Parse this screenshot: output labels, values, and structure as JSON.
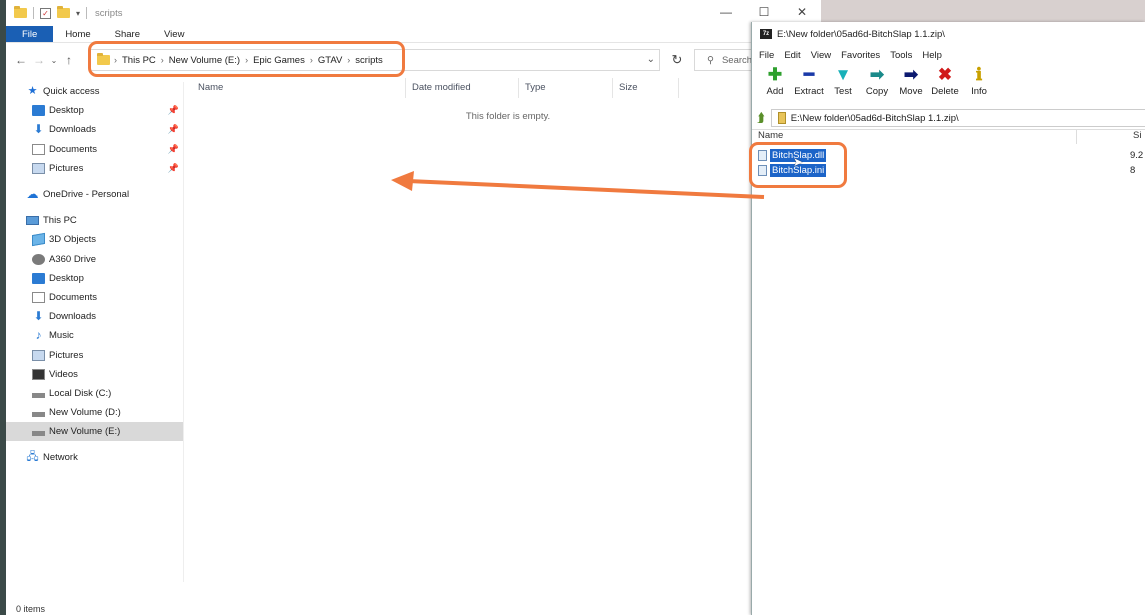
{
  "explorer": {
    "window_title": "scripts",
    "ribbon_tabs": [
      "File",
      "Home",
      "Share",
      "View"
    ],
    "breadcrumb": [
      "This PC",
      "New Volume (E:)",
      "Epic Games",
      "GTAV",
      "scripts"
    ],
    "search_placeholder": "Search",
    "nav_pane": [
      {
        "label": "Quick access",
        "icon": "star-icon",
        "pinned": false
      },
      {
        "label": "Desktop",
        "icon": "desktop-icon",
        "pinned": true
      },
      {
        "label": "Downloads",
        "icon": "download-icon",
        "pinned": true
      },
      {
        "label": "Documents",
        "icon": "documents-icon",
        "pinned": true
      },
      {
        "label": "Pictures",
        "icon": "pictures-icon",
        "pinned": true
      },
      {
        "label": "OneDrive - Personal",
        "icon": "cloud-icon",
        "pinned": false
      },
      {
        "label": "This PC",
        "icon": "computer-icon",
        "pinned": false
      },
      {
        "label": "3D Objects",
        "icon": "cube-icon",
        "pinned": false
      },
      {
        "label": "A360 Drive",
        "icon": "a360-icon",
        "pinned": false
      },
      {
        "label": "Desktop",
        "icon": "desktop-icon",
        "pinned": false
      },
      {
        "label": "Documents",
        "icon": "documents-icon",
        "pinned": false
      },
      {
        "label": "Downloads",
        "icon": "download-icon",
        "pinned": false
      },
      {
        "label": "Music",
        "icon": "music-icon",
        "pinned": false
      },
      {
        "label": "Pictures",
        "icon": "pictures-icon",
        "pinned": false
      },
      {
        "label": "Videos",
        "icon": "videos-icon",
        "pinned": false
      },
      {
        "label": "Local Disk (C:)",
        "icon": "drive-icon",
        "pinned": false
      },
      {
        "label": "New Volume (D:)",
        "icon": "drive-icon",
        "pinned": false
      },
      {
        "label": "New Volume (E:)",
        "icon": "drive-icon",
        "pinned": false,
        "selected": true
      },
      {
        "label": "Network",
        "icon": "network-icon",
        "pinned": false
      }
    ],
    "columns": [
      "Name",
      "Date modified",
      "Type",
      "Size"
    ],
    "empty_message": "This folder is empty.",
    "status": "0 items"
  },
  "sevenzip": {
    "title": "E:\\New folder\\05ad6d-BitchSlap 1.1.zip\\",
    "menu": [
      "File",
      "Edit",
      "View",
      "Favorites",
      "Tools",
      "Help"
    ],
    "toolbar": [
      {
        "label": "Add",
        "icon": "add-icon",
        "color": "#2ea02e",
        "glyph": "✚"
      },
      {
        "label": "Extract",
        "icon": "extract-icon",
        "color": "#1a3aa8",
        "glyph": "━"
      },
      {
        "label": "Test",
        "icon": "test-icon",
        "color": "#18b0b8",
        "glyph": "▼"
      },
      {
        "label": "Copy",
        "icon": "copy-icon",
        "color": "#1a8a8a",
        "glyph": "➡"
      },
      {
        "label": "Move",
        "icon": "move-icon",
        "color": "#0c1a70",
        "glyph": "➡"
      },
      {
        "label": "Delete",
        "icon": "delete-icon",
        "color": "#d01818",
        "glyph": "✖"
      },
      {
        "label": "Info",
        "icon": "info-icon",
        "color": "#c8a000",
        "glyph": "ℹ"
      }
    ],
    "path": "E:\\New folder\\05ad6d-BitchSlap 1.1.zip\\",
    "list_headers": [
      "Name",
      "Si"
    ],
    "files": [
      {
        "name": "BitchSlap.dll",
        "size": "9.2"
      },
      {
        "name": "BitchSlap.ini",
        "size": "8"
      }
    ]
  },
  "colors": {
    "accent": "#1a5fb4",
    "highlight": "#f07a3f"
  }
}
